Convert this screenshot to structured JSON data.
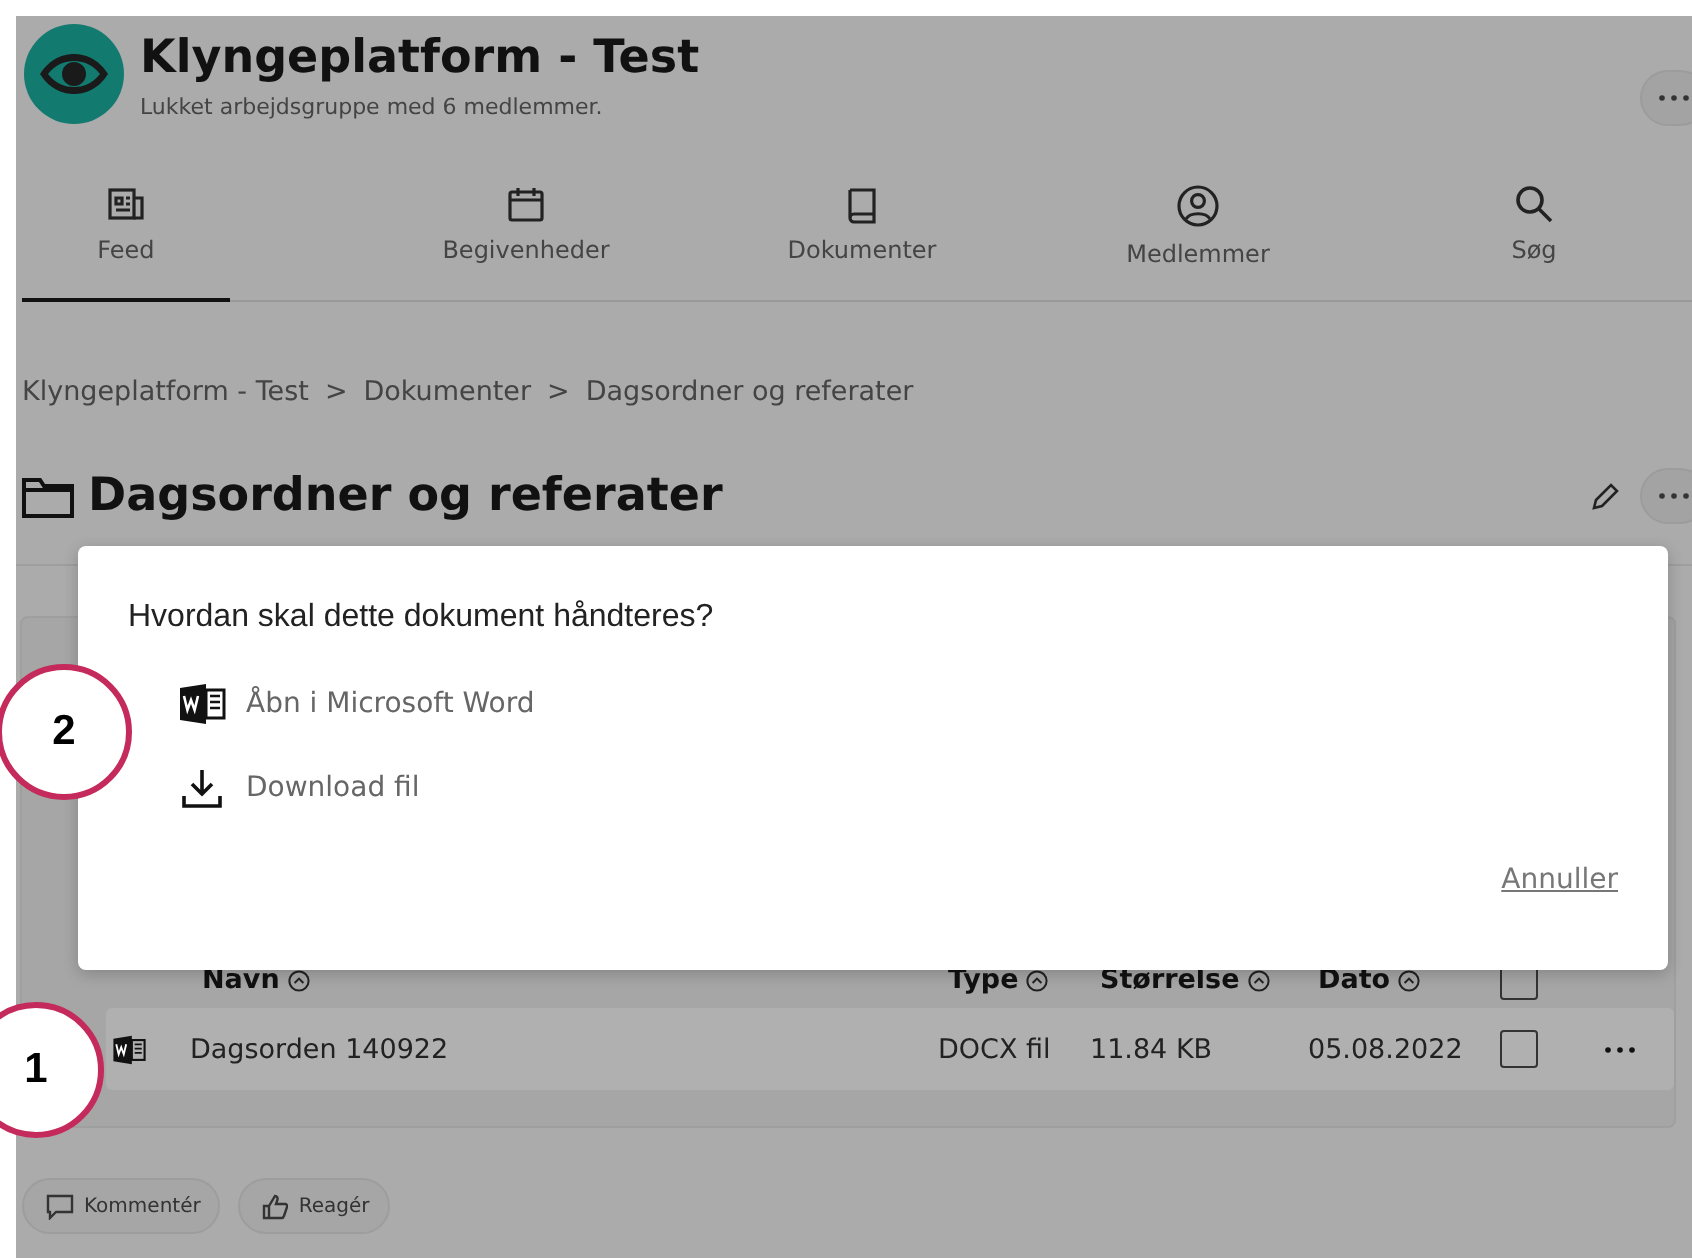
{
  "group": {
    "title": "Klyngeplatform - Test",
    "subtitle": "Lukket arbejdsgruppe med 6 medlemmer."
  },
  "tabs": [
    {
      "kind": "feed",
      "label": "Feed",
      "selected": true
    },
    {
      "kind": "events",
      "label": "Begivenheder",
      "selected": false
    },
    {
      "kind": "documents",
      "label": "Dokumenter",
      "selected": false
    },
    {
      "kind": "members",
      "label": "Medlemmer",
      "selected": false
    },
    {
      "kind": "search",
      "label": "Søg",
      "selected": false
    }
  ],
  "breadcrumb": {
    "separator": ">",
    "items": [
      "Klyngeplatform - Test",
      "Dokumenter",
      "Dagsordner og referater"
    ]
  },
  "folder": {
    "title": "Dagsordner og referater"
  },
  "table": {
    "columns": [
      "Navn",
      "Type",
      "Størrelse",
      "Dato"
    ],
    "select_all": {
      "checked": false
    },
    "rows": [
      {
        "name": "Dagsorden 140922",
        "type": "DOCX fil",
        "size": "11.84 KB",
        "date": "05.08.2022",
        "checked": false
      }
    ]
  },
  "actions": [
    {
      "kind": "comment",
      "label": "Kommentér"
    },
    {
      "kind": "react",
      "label": "Reagér"
    }
  ],
  "dialog": {
    "question": "Hvordan skal dette dokument håndteres?",
    "options": [
      {
        "kind": "word",
        "label": "Åbn i Microsoft Word"
      },
      {
        "kind": "download",
        "label": "Download fil"
      }
    ],
    "cancel": "Annuller"
  },
  "annotations": [
    {
      "label": "1"
    },
    {
      "label": "2"
    }
  ]
}
